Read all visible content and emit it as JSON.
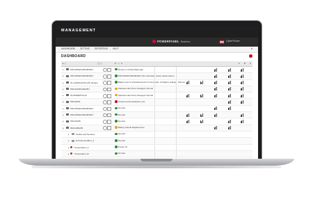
{
  "app": {
    "brand": "MANAGEMENT",
    "product": "POWERPANEL",
    "edition": "Business",
    "login": "CyberPower"
  },
  "menu": {
    "items": [
      "DASHBOARD",
      "SETTING",
      "REPORTING",
      "HELP"
    ],
    "right": "A"
  },
  "page": {
    "title": "DASHBOARD"
  },
  "grid": {
    "columns": [
      "A",
      "B",
      "C"
    ],
    "rows": [
      {
        "name": "PDU20SWHVIEC8FNET",
        "status": "Device in Critical Warnings",
        "color": "#2e8b3e"
      },
      {
        "name": "PDU15SWHVIEC8FNET",
        "status": "PDU20SWHVIEC8FNET has redundant power status issues",
        "color": "#2e8b3e"
      },
      {
        "name": "OL-1000XLRT2U-ZIP_Engine",
        "status": "Battery test is scheduled and not completed. Configure settings. Normal.",
        "color": "#2e8b3e"
      },
      {
        "name": "PDU41SWHVIEC8N",
        "status": "Wireless Hub Ports Changed: Normal",
        "color": "#e6a519"
      },
      {
        "name": "OL1500ERTXL2U",
        "status": "Wireless Hub Ports Changed: Normal",
        "color": "#e6a519"
      },
      {
        "name": "PDU41001",
        "status": "Circuit Communications Lost",
        "color": "#c8102e"
      },
      {
        "name": "PDU15SWHVIEC8FNET",
        "status": "Normal",
        "color": "#2e8b3e"
      },
      {
        "name": "PDU20SWHVIEC8FNET",
        "status": "Normal",
        "color": "#2e8b3e"
      },
      {
        "name": "PDU41005",
        "status": "Normal",
        "color": "#2e8b3e"
      },
      {
        "name": "RMCARD205",
        "status": "Battery Needs Replacement",
        "color": "#e6a519"
      },
      {
        "name": "Outlets and Sensors",
        "status": "Normal",
        "color": "#2e8b3e"
      },
      {
        "name": "EnvironmentMon_4",
        "status": "Normal",
        "color": "#2e8b3e"
      },
      {
        "name": "Temperature_A",
        "status": "Power off",
        "color": "#2e8b3e"
      },
      {
        "name": "Temperature_B",
        "status": "Normal",
        "color": "#2e8b3e"
      },
      {
        "name": "Humidity_A",
        "status": "Normal",
        "color": "#2e8b3e"
      },
      {
        "name": "Outlet_Control",
        "status": "Power off",
        "color": "#2e8b3e"
      }
    ]
  }
}
